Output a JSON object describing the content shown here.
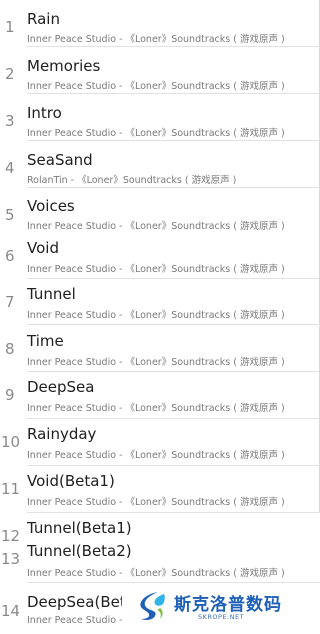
{
  "tracks": [
    {
      "number": "1",
      "title": "Rain",
      "subtitle": "Inner Peace Studio - 《Loner》Soundtracks ( 游戏原声 )"
    },
    {
      "number": "2",
      "title": "Memories",
      "subtitle": "Inner Peace Studio - 《Loner》Soundtracks ( 游戏原声 )"
    },
    {
      "number": "3",
      "title": "Intro",
      "subtitle": "Inner Peace Studio - 《Loner》Soundtracks ( 游戏原声 )"
    },
    {
      "number": "4",
      "title": "SeaSand",
      "subtitle": "RolanTin - 《Loner》Soundtracks ( 游戏原声 )"
    },
    {
      "number": "5",
      "title": "Voices",
      "subtitle": "Inner Peace Studio - 《Loner》Soundtracks ( 游戏原声 )"
    },
    {
      "number": "6",
      "title": "Void",
      "subtitle": "Inner Peace Studio - 《Loner》Soundtracks ( 游戏原声 )"
    },
    {
      "number": "7",
      "title": "Tunnel",
      "subtitle": "Inner Peace Studio - 《Loner》Soundtracks ( 游戏原声 )"
    },
    {
      "number": "8",
      "title": "Time",
      "subtitle": "Inner Peace Studio - 《Loner》Soundtracks ( 游戏原声 )"
    },
    {
      "number": "9",
      "title": "DeepSea",
      "subtitle": "Inner Peace Studio - 《Loner》Soundtracks ( 游戏原声 )"
    },
    {
      "number": "10",
      "title": "Rainyday",
      "subtitle": "Inner Peace Studio - 《Loner》Soundtracks ( 游戏原声 )"
    },
    {
      "number": "11",
      "title": "Void(Beta1)",
      "subtitle": "Inner Peace Studio - 《Loner》Soundtracks ( 游戏原声 )"
    },
    {
      "number": "12",
      "title": "Tunnel(Beta1)",
      "subtitle": ""
    },
    {
      "number": "13",
      "title": "Tunnel(Beta2)",
      "subtitle": "Inner Peace Studio - 《Loner》Soundtracks ( 游戏原声 )"
    },
    {
      "number": "14",
      "title": "DeepSea(Beta",
      "subtitle": "Inner Peace Studio -"
    }
  ],
  "watermark": {
    "title": "斯克洛普数码",
    "url": "SKROPE.NET",
    "logo_colors": [
      "#1e5fb8",
      "#2fb3e8",
      "#7cc242"
    ]
  }
}
